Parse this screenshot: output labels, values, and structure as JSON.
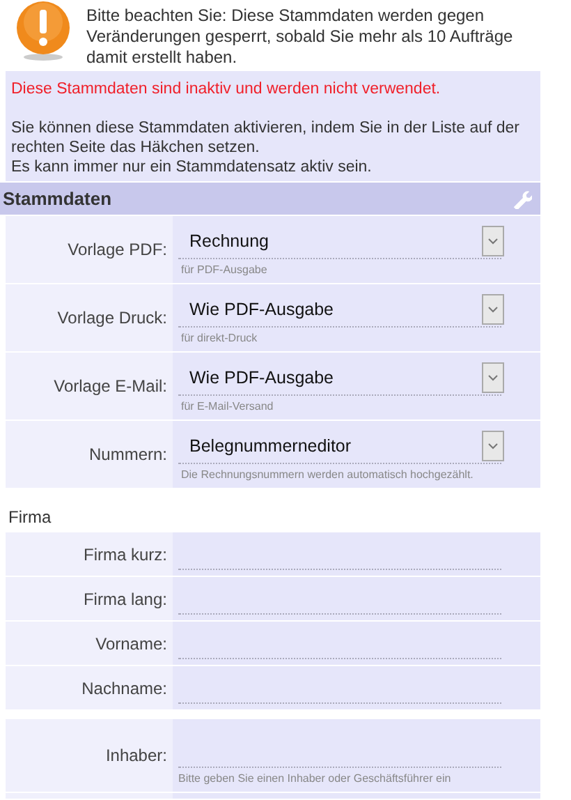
{
  "notice": {
    "text": "Bitte beachten Sie: Diese Stammdaten werden gegen Veränderungen gesperrt, sobald Sie mehr als 10 Aufträge damit erstellt haben."
  },
  "status_panel": {
    "warning": "Diese Stammdaten sind inaktiv und werden nicht verwendet.",
    "lines": [
      "Sie können diese Stammdaten aktivieren, indem Sie in der Liste auf der rechten Seite das Häkchen setzen.",
      "Es kann immer nur ein Stammdatensatz aktiv sein."
    ]
  },
  "section": {
    "title": "Stammdaten"
  },
  "selects": [
    {
      "label": "Vorlage PDF:",
      "value": "Rechnung",
      "hint": "für PDF-Ausgabe"
    },
    {
      "label": "Vorlage Druck:",
      "value": "Wie PDF-Ausgabe",
      "hint": "für direkt-Druck"
    },
    {
      "label": "Vorlage E-Mail:",
      "value": "Wie PDF-Ausgabe",
      "hint": "für E-Mail-Versand"
    },
    {
      "label": "Nummern:",
      "value": "Belegnummerneditor",
      "hint": "Die Rechnungsnummern werden automatisch hochgezählt."
    }
  ],
  "company": {
    "heading": "Firma",
    "groups": [
      {
        "fields": [
          {
            "label": "Firma kurz:"
          },
          {
            "label": "Firma lang:"
          },
          {
            "label": "Vorname:"
          },
          {
            "label": "Nachname:"
          }
        ]
      },
      {
        "fields": [
          {
            "label": "Inhaber:",
            "hint": "Bitte geben Sie einen Inhaber oder Geschäftsführer ein"
          }
        ]
      }
    ]
  }
}
